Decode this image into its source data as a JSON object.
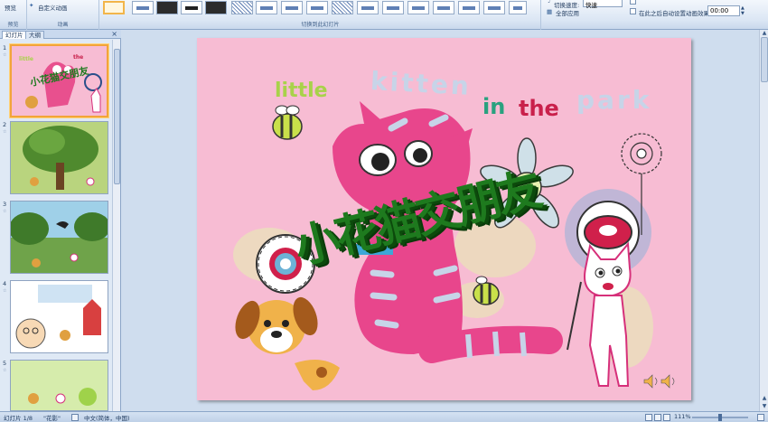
{
  "ribbon": {
    "preview_label": "预览",
    "custom_anim_label": "自定义动画",
    "group_preview": "预览",
    "group_animation": "动画",
    "group_transitions": "切换到此幻灯片",
    "transition_speed_label": "切换速度:",
    "transition_speed_value": "快速",
    "apply_all_label": "全部应用",
    "auto_after_label": "在此之后自动设置动画效果:",
    "auto_after_value": "00:00"
  },
  "left_pane": {
    "tab_slides": "幻灯片",
    "tab_outline": "大纲",
    "close": "×",
    "slides": [
      {
        "num": "1",
        "star": "☆"
      },
      {
        "num": "2",
        "star": "☆"
      },
      {
        "num": "3",
        "star": "☆"
      },
      {
        "num": "4",
        "star": "☆"
      },
      {
        "num": "5",
        "star": "☆"
      }
    ]
  },
  "slide": {
    "word_little": "little",
    "word_kitten": "kitten",
    "word_in": "in",
    "word_the": "the",
    "word_park": "park",
    "title_cn": "小花猫交朋友"
  },
  "status": {
    "slide_info": "幻灯片 1/8",
    "theme": "\"花影\"",
    "language": "中文(简体，中国)",
    "zoom": "111%"
  },
  "colors": {
    "slide_bg": "#f7bcd3",
    "title_green": "#1e7a1e",
    "little_color": "#a8d24a",
    "in_color": "#2aa17f",
    "the_color": "#c9204b",
    "kitten_park_color": "#c7d4e8"
  }
}
